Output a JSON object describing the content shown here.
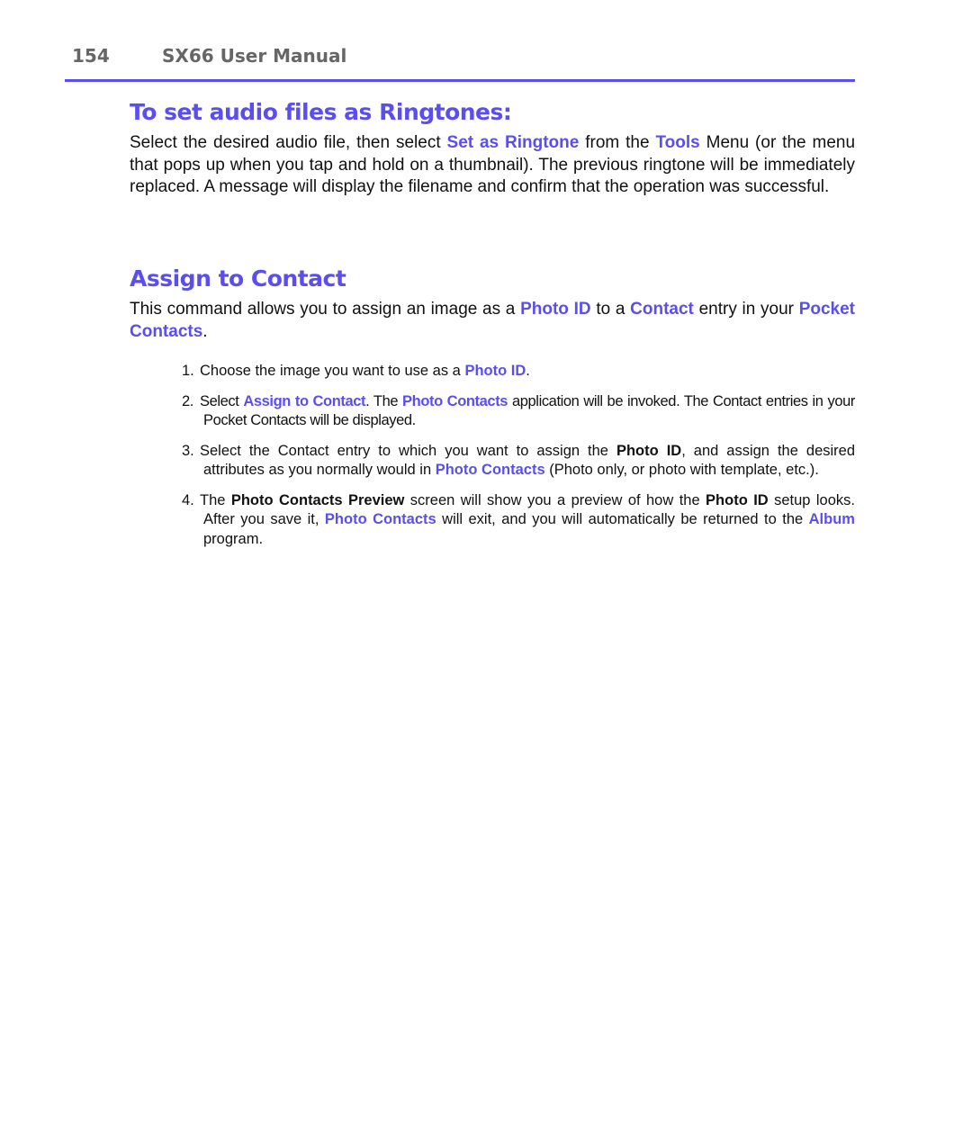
{
  "header": {
    "page_number": "154",
    "title": "SX66 User Manual",
    "accent_color": "#5a4ef0"
  },
  "section1": {
    "heading": "To set audio files as Ringtones:",
    "p": [
      "Select the desired audio file, then select ",
      "Set as Ringtone",
      " from the ",
      "Tools",
      " Menu (or the menu that pops up when you tap and hold on a thumbnail). The previous ringtone will be immediately replaced. A message will display the filename and confirm that the operation was successful."
    ]
  },
  "section2": {
    "heading": "Assign to Contact",
    "p": [
      "This command allows you to assign an image as a ",
      "Photo ID",
      " to a ",
      "Contact",
      " entry in your ",
      "Pocket Contacts",
      "."
    ],
    "steps": [
      {
        "n": "1.",
        "parts": [
          "Choose the image you want to use as a ",
          "Photo ID",
          "."
        ]
      },
      {
        "n": "2.",
        "parts": [
          "Select ",
          "Assign to Contact",
          ". The ",
          "Photo Contacts",
          " application will be invoked. The Contact entries in your Pocket Contacts will be displayed."
        ]
      },
      {
        "n": "3.",
        "parts": [
          "Select the Contact entry to which you want to assign the ",
          "Photo ID",
          ", and assign the desired attributes as you normally would in ",
          "Photo Contacts",
          " (Photo only, or photo with template, etc.)."
        ]
      },
      {
        "n": "4.",
        "parts": [
          "The ",
          "Photo Contacts Preview",
          " screen will show you a preview of how the ",
          "Photo ID",
          " setup looks. After you save it, ",
          "Photo Contacts",
          " will exit, and you will automatically be returned to the ",
          "Album",
          " program."
        ]
      }
    ]
  }
}
